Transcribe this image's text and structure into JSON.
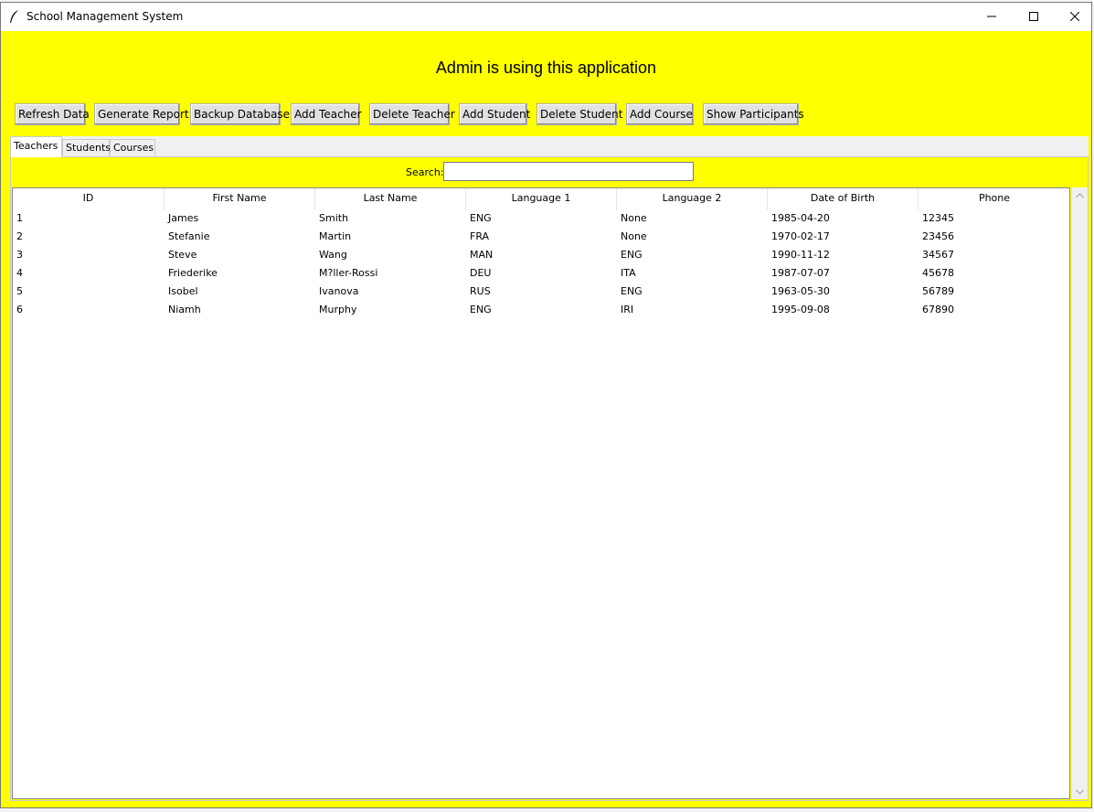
{
  "window": {
    "title": "School Management System"
  },
  "banner": {
    "text": "Admin is using this application"
  },
  "toolbar": {
    "buttons": [
      {
        "label": "Refresh Data"
      },
      {
        "label": "Generate Report"
      },
      {
        "label": "Backup Database"
      },
      {
        "label": "Add Teacher"
      },
      {
        "label": "Delete Teacher"
      },
      {
        "label": "Add Student"
      },
      {
        "label": "Delete Student"
      },
      {
        "label": "Add Course"
      },
      {
        "label": "Show Participants"
      }
    ]
  },
  "tabs": [
    {
      "label": "Teachers",
      "active": true
    },
    {
      "label": "Students",
      "active": false
    },
    {
      "label": "Courses",
      "active": false
    }
  ],
  "search": {
    "label": "Search:",
    "value": ""
  },
  "table": {
    "columns": [
      "ID",
      "First Name",
      "Last Name",
      "Language 1",
      "Language 2",
      "Date of Birth",
      "Phone"
    ],
    "rows": [
      [
        "1",
        "James",
        "Smith",
        "ENG",
        "None",
        "1985-04-20",
        "12345"
      ],
      [
        "2",
        "Stefanie",
        "Martin",
        "FRA",
        "None",
        "1970-02-17",
        "23456"
      ],
      [
        "3",
        "Steve",
        "Wang",
        "MAN",
        "ENG",
        "1990-11-12",
        "34567"
      ],
      [
        "4",
        "Friederike",
        "M?ller-Rossi",
        "DEU",
        "ITA",
        "1987-07-07",
        "45678"
      ],
      [
        "5",
        "Isobel",
        "Ivanova",
        "RUS",
        "ENG",
        "1963-05-30",
        "56789"
      ],
      [
        "6",
        "Niamh",
        "Murphy",
        "ENG",
        "IRI",
        "1995-09-08",
        "67890"
      ]
    ]
  },
  "colors": {
    "background": "#ffff00",
    "titlebar": "#ffffff",
    "button_face": "#e1e1e1"
  }
}
